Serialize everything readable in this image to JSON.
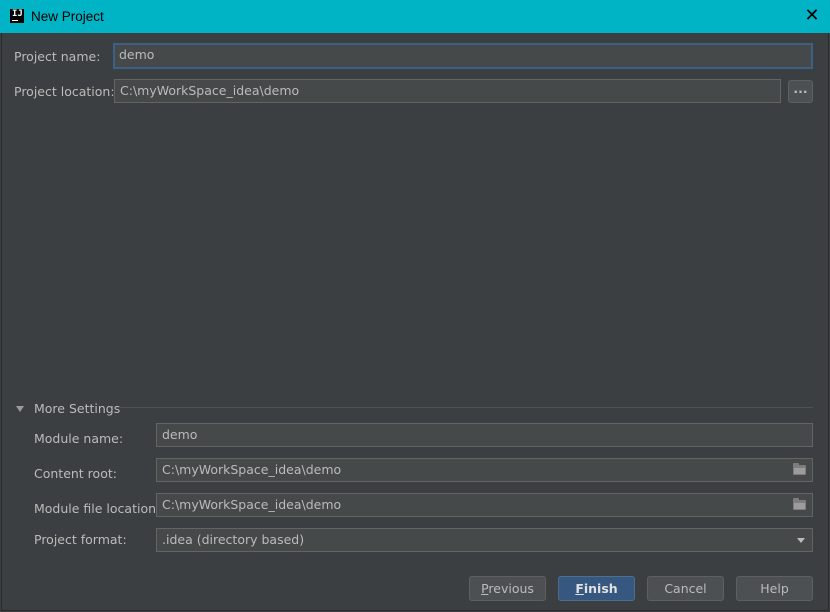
{
  "window": {
    "title": "New Project",
    "app_icon_text": "IJ"
  },
  "project": {
    "name_label": "Project name:",
    "name_value": "demo",
    "location_label": "Project location:",
    "location_value": "C:\\myWorkSpace_idea\\demo",
    "browse_label": "..."
  },
  "more_settings": {
    "header": "More Settings",
    "module_name_label": "Module name:",
    "module_name_value": "demo",
    "content_root_label": "Content root:",
    "content_root_value": "C:\\myWorkSpace_idea\\demo",
    "module_file_label": "Module file location:",
    "module_file_value": "C:\\myWorkSpace_idea\\demo",
    "format_label": "Project format:",
    "format_value": ".idea (directory based)"
  },
  "buttons": {
    "previous_first": "P",
    "previous_rest": "revious",
    "finish_first": "F",
    "finish_rest": "inish",
    "cancel": "Cancel",
    "help": "Help"
  },
  "colors": {
    "titlebar": "#00b4c6",
    "background": "#3c3f41",
    "field": "#45494a",
    "focus_border": "#3d6185",
    "primary_button": "#365880"
  }
}
